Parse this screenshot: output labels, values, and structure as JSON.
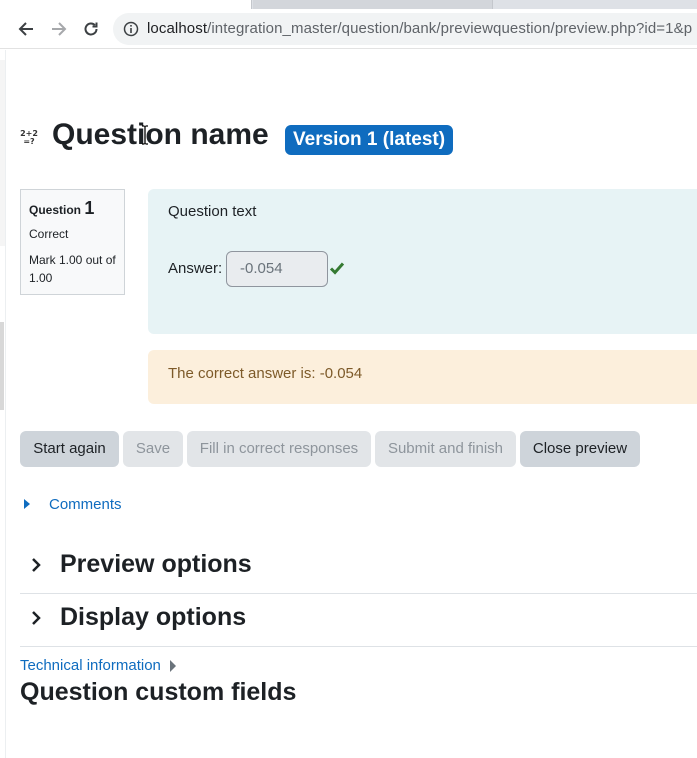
{
  "browser": {
    "url_host": "localhost",
    "url_path": "/integration_master/question/bank/previewquestion/preview.php?id=1&p"
  },
  "header": {
    "question_icon_top": "2+2",
    "question_icon_bottom": "=?",
    "title": "Question name",
    "version_badge": "Version 1 (latest)"
  },
  "question_info": {
    "label": "Question",
    "number": "1",
    "state": "Correct",
    "grade": "Mark 1.00 out of 1.00"
  },
  "formulation": {
    "question_text": "Question text",
    "answer_label": "Answer:",
    "answer_value": "-0.054"
  },
  "feedback": {
    "right_answer": "The correct answer is: -0.054"
  },
  "buttons": {
    "start_again": "Start again",
    "save": "Save",
    "fill_correct": "Fill in correct responses",
    "submit_finish": "Submit and finish",
    "close_preview": "Close preview"
  },
  "comments": {
    "label": "Comments"
  },
  "sections": {
    "preview_options": "Preview options",
    "display_options": "Display options"
  },
  "technical_info": "Technical information",
  "custom_fields_title": "Question custom fields",
  "colors": {
    "primary": "#0f6cbf",
    "success": "#357a32",
    "formulation_bg": "#e7f3f5",
    "feedback_bg": "#fcefdc"
  }
}
